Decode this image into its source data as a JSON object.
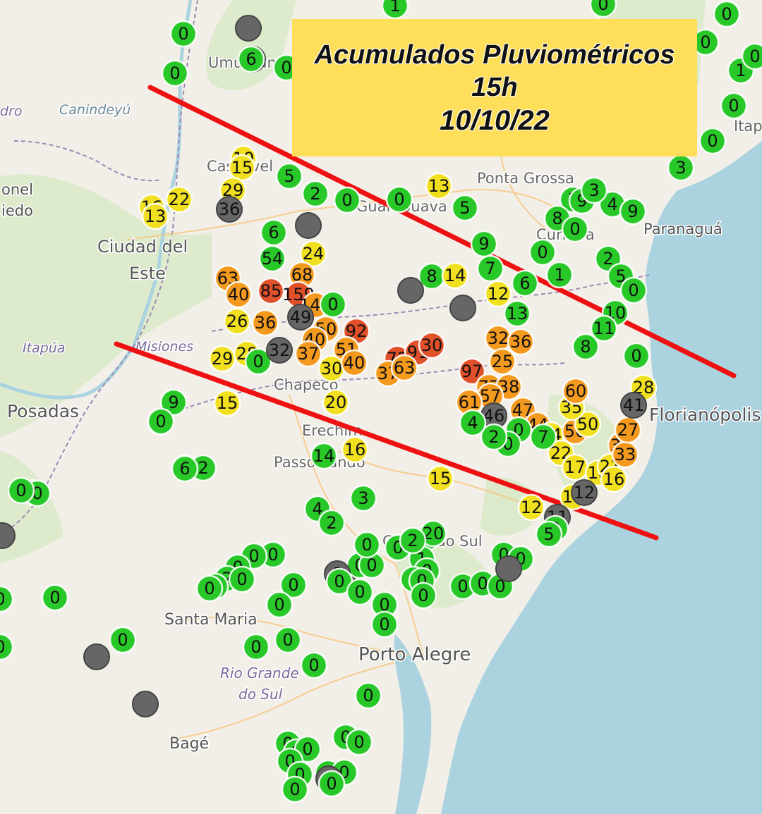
{
  "title": {
    "line1": "Acumulados Pluviométricos",
    "line2": "15h",
    "line3": "10/10/22"
  },
  "colors": {
    "water": "#aad3df",
    "land": "#f2efe9",
    "forest": "#cfe6b8",
    "border": "#9e8ab5",
    "road": "#f7c57a",
    "line": "#ee1111",
    "title_bg": "#ffde59",
    "green": "#28c828",
    "yellow": "#f0e020",
    "orange": "#f39a1e",
    "red": "#e0502a",
    "gray": "#666666"
  },
  "place_labels": [
    {
      "text": "Umuarama",
      "kind": "city"
    },
    {
      "text": "Canindeyú",
      "kind": "region"
    },
    {
      "text": "Cascavel",
      "kind": "city"
    },
    {
      "text": "Guarapuava",
      "kind": "city"
    },
    {
      "text": "Ponta Grossa",
      "kind": "city"
    },
    {
      "text": "Curitiba",
      "kind": "city"
    },
    {
      "text": "Paranaguá",
      "kind": "city"
    },
    {
      "text": "Itapema",
      "kind": "city"
    },
    {
      "text": "Ciudad del",
      "kind": "city"
    },
    {
      "text": "Este",
      "kind": "city"
    },
    {
      "text": "Itapúa",
      "kind": "region"
    },
    {
      "text": "Misiones",
      "kind": "region"
    },
    {
      "text": "Posadas",
      "kind": "city"
    },
    {
      "text": "Chapecó",
      "kind": "city"
    },
    {
      "text": "Erechim",
      "kind": "city"
    },
    {
      "text": "Passo Fundo",
      "kind": "city"
    },
    {
      "text": "Caxias do Sul",
      "kind": "city"
    },
    {
      "text": "Florianópolis",
      "kind": "city"
    },
    {
      "text": "Santa Maria",
      "kind": "city"
    },
    {
      "text": "Porto Alegre",
      "kind": "city"
    },
    {
      "text": "Rio Grande",
      "kind": "region"
    },
    {
      "text": "do Sul",
      "kind": "region"
    },
    {
      "text": "Bagé",
      "kind": "city"
    },
    {
      "text": "onel",
      "kind": "city"
    },
    {
      "text": "iedo",
      "kind": "city"
    },
    {
      "text": "dro",
      "kind": "region"
    }
  ],
  "stations": [
    {
      "v": "0",
      "c": "green"
    },
    {
      "v": "0",
      "c": "green"
    },
    {
      "v": "",
      "c": "gray"
    },
    {
      "v": "",
      "c": "gray"
    },
    {
      "v": "0",
      "c": "green"
    },
    {
      "v": "1",
      "c": "green"
    },
    {
      "v": "0",
      "c": "green"
    },
    {
      "v": "10",
      "c": "yellow"
    },
    {
      "v": "15",
      "c": "yellow"
    },
    {
      "v": "5",
      "c": "green"
    },
    {
      "v": "2",
      "c": "green"
    },
    {
      "v": "0",
      "c": "green"
    },
    {
      "v": "0",
      "c": "green"
    },
    {
      "v": "13",
      "c": "yellow"
    },
    {
      "v": "5",
      "c": "green"
    },
    {
      "v": "29",
      "c": "yellow"
    },
    {
      "v": "36",
      "c": "gray"
    },
    {
      "v": "16",
      "c": "yellow"
    },
    {
      "v": "13",
      "c": "yellow"
    },
    {
      "v": "22",
      "c": "yellow"
    },
    {
      "v": "6",
      "c": "green"
    },
    {
      "v": "",
      "c": "gray"
    },
    {
      "v": "24",
      "c": "yellow"
    },
    {
      "v": "54",
      "c": "green"
    },
    {
      "v": "68",
      "c": "orange"
    },
    {
      "v": "63",
      "c": "orange"
    },
    {
      "v": "40",
      "c": "orange"
    },
    {
      "v": "85",
      "c": "red"
    },
    {
      "v": "159",
      "c": "red"
    },
    {
      "v": "142",
      "c": "orange"
    },
    {
      "v": "0",
      "c": "green"
    },
    {
      "v": "8",
      "c": "green"
    },
    {
      "v": "14",
      "c": "yellow"
    },
    {
      "v": "",
      "c": "gray"
    },
    {
      "v": "",
      "c": "gray"
    },
    {
      "v": "26",
      "c": "yellow"
    },
    {
      "v": "36",
      "c": "orange"
    },
    {
      "v": "49",
      "c": "gray"
    },
    {
      "v": "50",
      "c": "orange"
    },
    {
      "v": "92",
      "c": "red"
    },
    {
      "v": "40",
      "c": "orange"
    },
    {
      "v": "29",
      "c": "yellow"
    },
    {
      "v": "28",
      "c": "yellow"
    },
    {
      "v": "0",
      "c": "green"
    },
    {
      "v": "32",
      "c": "gray"
    },
    {
      "v": "37",
      "c": "orange"
    },
    {
      "v": "51",
      "c": "orange"
    },
    {
      "v": "72",
      "c": "red"
    },
    {
      "v": "91",
      "c": "red"
    },
    {
      "v": "30",
      "c": "red"
    },
    {
      "v": "30",
      "c": "yellow"
    },
    {
      "v": "40",
      "c": "orange"
    },
    {
      "v": "37",
      "c": "orange"
    },
    {
      "v": "63",
      "c": "orange"
    },
    {
      "v": "97",
      "c": "red"
    },
    {
      "v": "15",
      "c": "yellow"
    },
    {
      "v": "20",
      "c": "yellow"
    },
    {
      "v": "9",
      "c": "green"
    },
    {
      "v": "6",
      "c": "green"
    },
    {
      "v": "4",
      "c": "green"
    },
    {
      "v": "2",
      "c": "green"
    },
    {
      "v": "14",
      "c": "green"
    },
    {
      "v": "16",
      "c": "yellow"
    },
    {
      "v": "15",
      "c": "yellow"
    },
    {
      "v": "2",
      "c": "green"
    },
    {
      "v": "3",
      "c": "green"
    },
    {
      "v": "4",
      "c": "green"
    },
    {
      "v": "2",
      "c": "green"
    },
    {
      "v": "9",
      "c": "green"
    },
    {
      "v": "0",
      "c": "green"
    },
    {
      "v": "7",
      "c": "green"
    },
    {
      "v": "12",
      "c": "yellow"
    },
    {
      "v": "6",
      "c": "green"
    },
    {
      "v": "1",
      "c": "green"
    },
    {
      "v": "13",
      "c": "green"
    },
    {
      "v": "32",
      "c": "orange"
    },
    {
      "v": "36",
      "c": "orange"
    },
    {
      "v": "25",
      "c": "orange"
    },
    {
      "v": "77",
      "c": "orange"
    },
    {
      "v": "38",
      "c": "orange"
    },
    {
      "v": "57",
      "c": "orange"
    },
    {
      "v": "61",
      "c": "orange"
    },
    {
      "v": "47",
      "c": "orange"
    },
    {
      "v": "46",
      "c": "gray"
    },
    {
      "v": "44",
      "c": "orange"
    },
    {
      "v": "34",
      "c": "yellow"
    },
    {
      "v": "56",
      "c": "orange"
    },
    {
      "v": "50",
      "c": "yellow"
    },
    {
      "v": "35",
      "c": "yellow"
    },
    {
      "v": "22",
      "c": "yellow"
    },
    {
      "v": "17",
      "c": "yellow"
    },
    {
      "v": "18",
      "c": "yellow"
    },
    {
      "v": "21",
      "c": "yellow"
    },
    {
      "v": "16",
      "c": "yellow"
    },
    {
      "v": "12",
      "c": "yellow"
    },
    {
      "v": "14",
      "c": "yellow"
    },
    {
      "v": "11",
      "c": "gray"
    },
    {
      "v": "12",
      "c": "gray"
    },
    {
      "v": "2",
      "c": "green"
    },
    {
      "v": "5",
      "c": "green"
    },
    {
      "v": "2",
      "c": "green"
    },
    {
      "v": "5",
      "c": "green"
    },
    {
      "v": "3",
      "c": "green"
    },
    {
      "v": "4",
      "c": "green"
    },
    {
      "v": "9",
      "c": "green"
    },
    {
      "v": "0",
      "c": "green"
    },
    {
      "v": "10",
      "c": "green"
    },
    {
      "v": "11",
      "c": "green"
    },
    {
      "v": "8",
      "c": "green"
    },
    {
      "v": "0",
      "c": "green"
    },
    {
      "v": "35",
      "c": "orange"
    },
    {
      "v": "33",
      "c": "orange"
    },
    {
      "v": "28",
      "c": "yellow"
    },
    {
      "v": "27",
      "c": "orange"
    },
    {
      "v": "41",
      "c": "gray"
    },
    {
      "v": "60",
      "c": "orange"
    },
    {
      "v": "2",
      "c": "green"
    },
    {
      "v": "20",
      "c": "green"
    },
    {
      "v": "0",
      "c": "green"
    },
    {
      "v": "0",
      "c": "green"
    },
    {
      "v": "0",
      "c": "green"
    },
    {
      "v": "0",
      "c": "green"
    },
    {
      "v": "0",
      "c": "green"
    },
    {
      "v": "2",
      "c": "green"
    },
    {
      "v": "0",
      "c": "green"
    },
    {
      "v": "0",
      "c": "green"
    },
    {
      "v": "0",
      "c": "green"
    },
    {
      "v": "0",
      "c": "gray"
    },
    {
      "v": "0",
      "c": "green"
    },
    {
      "v": "0",
      "c": "green"
    },
    {
      "v": "0",
      "c": "green"
    },
    {
      "v": "0",
      "c": "green"
    },
    {
      "v": "1",
      "c": "green"
    },
    {
      "v": "2",
      "c": "green"
    },
    {
      "v": "0",
      "c": "green"
    },
    {
      "v": "0",
      "c": "green"
    },
    {
      "v": "0",
      "c": "gray"
    },
    {
      "v": "0",
      "c": "green"
    },
    {
      "v": "0",
      "c": "green"
    },
    {
      "v": "0",
      "c": "green"
    },
    {
      "v": "0",
      "c": "green"
    },
    {
      "v": "0",
      "c": "green"
    },
    {
      "v": "0",
      "c": "green"
    },
    {
      "v": "",
      "c": "gray"
    },
    {
      "v": "0",
      "c": "green"
    },
    {
      "v": "0",
      "c": "green"
    },
    {
      "v": "0",
      "c": "green"
    },
    {
      "v": "0",
      "c": "green"
    },
    {
      "v": "0",
      "c": "green"
    },
    {
      "v": "",
      "c": "gray"
    },
    {
      "v": "0",
      "c": "green"
    },
    {
      "v": "0",
      "c": "green"
    },
    {
      "v": "0",
      "c": "green"
    },
    {
      "v": "0",
      "c": "green"
    },
    {
      "v": "",
      "c": "gray"
    },
    {
      "v": "0",
      "c": "green"
    },
    {
      "v": "0",
      "c": "green"
    },
    {
      "v": "0",
      "c": "green"
    },
    {
      "v": "0",
      "c": "green"
    },
    {
      "v": "0",
      "c": "green"
    },
    {
      "v": "0",
      "c": "green"
    },
    {
      "v": "0",
      "c": "green"
    },
    {
      "v": "0",
      "c": "green"
    },
    {
      "v": "0",
      "c": "green"
    },
    {
      "v": "0",
      "c": "gray"
    },
    {
      "v": "0",
      "c": "green"
    },
    {
      "v": "0",
      "c": "green"
    },
    {
      "v": "0",
      "c": "green"
    },
    {
      "v": "",
      "c": "gray"
    },
    {
      "v": "0",
      "c": "green"
    },
    {
      "v": "0",
      "c": "green"
    },
    {
      "v": "0",
      "c": "green"
    },
    {
      "v": "0",
      "c": "green"
    },
    {
      "v": "0",
      "c": "green"
    },
    {
      "v": "6",
      "c": "green"
    },
    {
      "v": "0",
      "c": "green"
    },
    {
      "v": "1",
      "c": "green"
    },
    {
      "v": "0",
      "c": "green"
    },
    {
      "v": "0",
      "c": "green"
    },
    {
      "v": "0",
      "c": "green"
    },
    {
      "v": "3",
      "c": "green"
    },
    {
      "v": "0",
      "c": "green"
    },
    {
      "v": "0",
      "c": "green"
    },
    {
      "v": "8",
      "c": "green"
    },
    {
      "v": "0",
      "c": "green"
    },
    {
      "v": "0",
      "c": "green"
    },
    {
      "v": "7",
      "c": "green"
    },
    {
      "v": "0",
      "c": "green"
    },
    {
      "v": "2",
      "c": "green"
    },
    {
      "v": "4",
      "c": "green"
    },
    {
      "v": "9",
      "c": "green"
    },
    {
      "v": "3",
      "c": "green"
    },
    {
      "v": "0",
      "c": "green"
    },
    {
      "v": "6",
      "c": "green"
    },
    {
      "v": "0",
      "c": "green"
    },
    {
      "v": "0",
      "c": "green"
    },
    {
      "v": "0",
      "c": "green"
    },
    {
      "v": "10",
      "c": "green"
    },
    {
      "v": "0",
      "c": "green"
    },
    {
      "v": "2",
      "c": "green"
    },
    {
      "v": "2",
      "c": "green"
    },
    {
      "v": "0",
      "c": "green"
    },
    {
      "v": "0",
      "c": "green"
    },
    {
      "v": "",
      "c": "gray"
    },
    {
      "v": "",
      "c": "gray"
    }
  ],
  "trend_lines": [
    {
      "name": "upper-band-line"
    },
    {
      "name": "lower-band-line"
    }
  ]
}
